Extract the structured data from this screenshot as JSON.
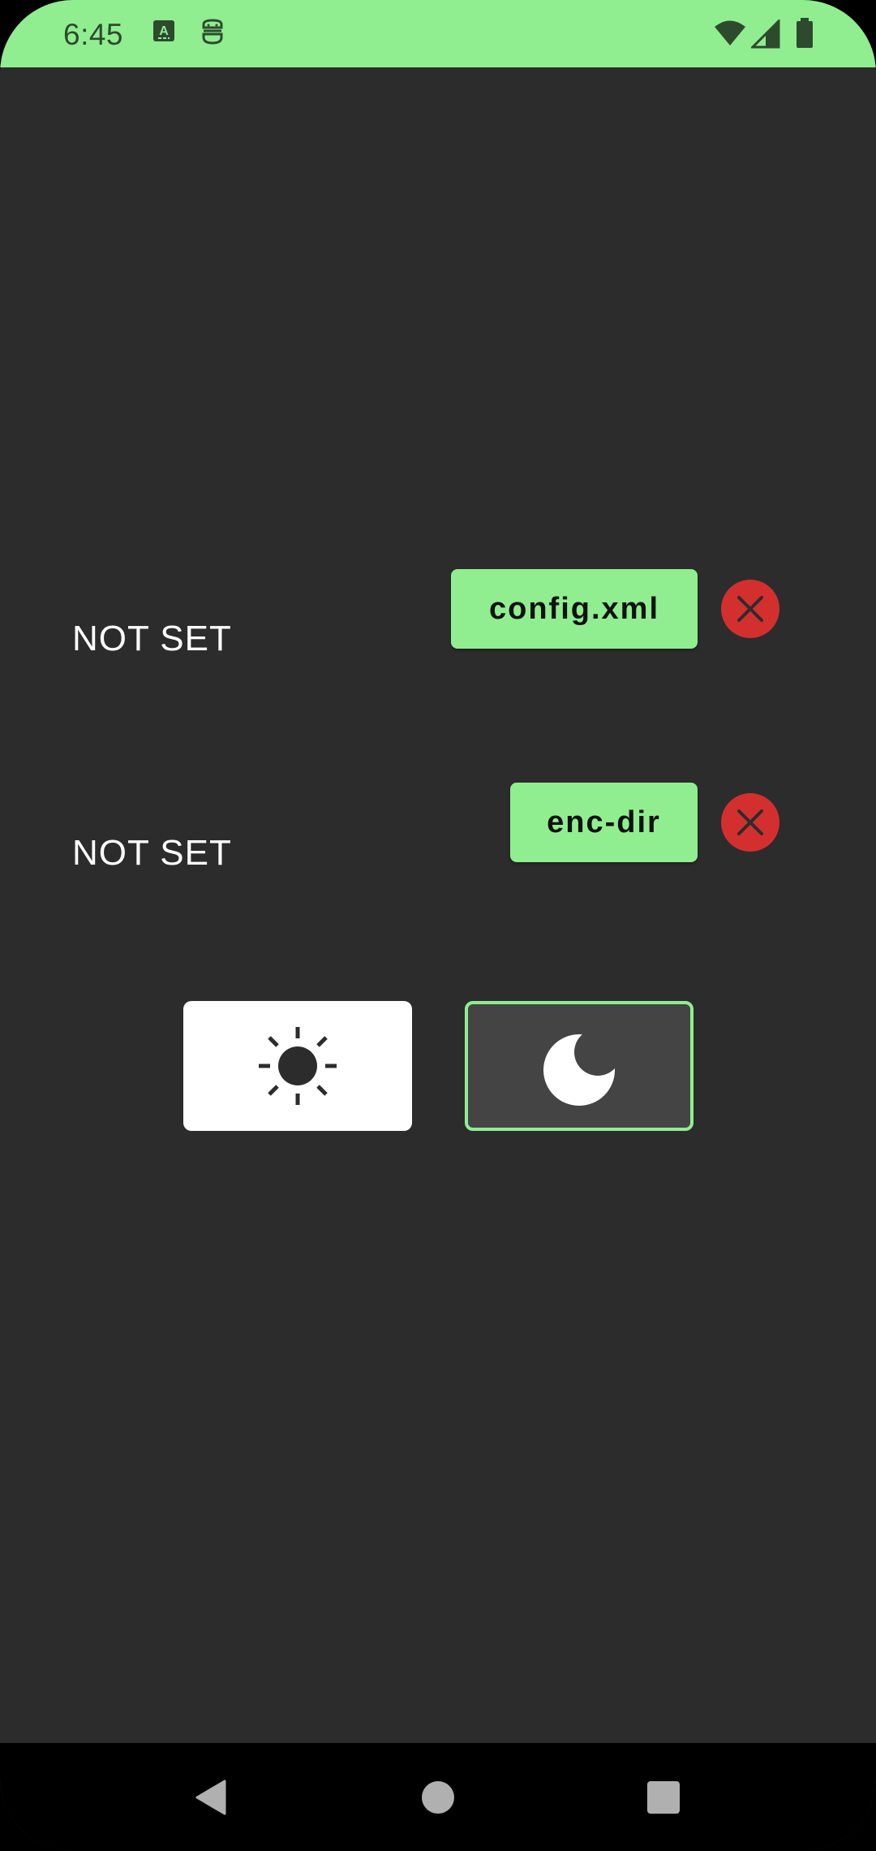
{
  "status_bar": {
    "time": "6:45",
    "background": "#90ee90",
    "left_icons": [
      "text-a-icon",
      "robot-face-icon"
    ],
    "right_icons": [
      "wifi-icon",
      "cell-signal-icon",
      "battery-icon"
    ]
  },
  "file_rows": [
    {
      "status": "NOT SET",
      "chip_label": "config.xml",
      "remove_icon": "close-icon"
    },
    {
      "status": "NOT SET",
      "chip_label": "enc-dir",
      "remove_icon": "close-icon"
    }
  ],
  "theme_selector": {
    "options": [
      {
        "name": "light",
        "icon": "sun-icon",
        "selected": false
      },
      {
        "name": "dark",
        "icon": "moon-icon",
        "selected": true
      }
    ]
  },
  "colors": {
    "accent": "#90ee90",
    "background": "#2c2c2c",
    "danger": "#d32f2f"
  },
  "nav_bar": {
    "items": [
      "back-icon",
      "home-icon",
      "recents-icon"
    ]
  }
}
